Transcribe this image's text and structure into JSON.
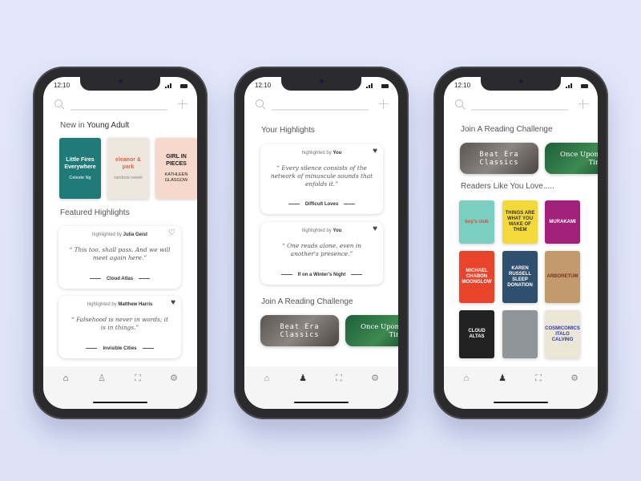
{
  "status_time": "12:10",
  "nav_icons": [
    "home-icon",
    "profile-icon",
    "scan-icon",
    "gear-icon"
  ],
  "screens": [
    {
      "active_nav": 0,
      "section_prefix": "New in",
      "section_genre": "Young Adult",
      "books": [
        {
          "title": "Little Fires Everywhere",
          "author": "Celeste Ng",
          "bg": "#1f7a78",
          "fg": "#ffffff"
        },
        {
          "title": "eleanor & park",
          "author": "rainbow rowell",
          "bg": "#ece6dc",
          "fg": "#e0664e"
        },
        {
          "title": "GIRL IN PIECES",
          "author": "KATHLEEN GLASGOW",
          "bg": "#f6d9cb",
          "fg": "#222222"
        }
      ],
      "featured_heading": "Featured Highlights",
      "highlights": [
        {
          "by_label": "highlighted by",
          "user": "Julia Geist",
          "quote": "“ This too, shall pass. And we will meet again here.”",
          "source": "Cloud Atlas",
          "liked": false
        },
        {
          "by_label": "highlighted by",
          "user": "Matthew Harris",
          "quote": "“ Falsehood is never in words; it is in things.”",
          "source": "Invisible Cities",
          "liked": true
        }
      ]
    },
    {
      "active_nav": 1,
      "heading": "Your Highlights",
      "highlights": [
        {
          "by_label": "highlighted by",
          "user": "You",
          "quote": "“ Every silence consists of the network of minuscule sounds that enfolds it.”",
          "source": "Difficult Loves",
          "liked": true
        },
        {
          "by_label": "highlighted by",
          "user": "You",
          "quote": "“ One reads alone, even in another's presence.”",
          "source": "If on a Winter's Night",
          "liked": true
        }
      ],
      "challenge_heading": "Join A Reading Challenge",
      "challenges": [
        {
          "label": "Beat Era Classics"
        },
        {
          "label": "Once Upon A Time"
        }
      ]
    },
    {
      "active_nav": 1,
      "challenge_heading": "Join A Reading Challenge",
      "challenges": [
        {
          "label": "Beat Era Classics"
        },
        {
          "label": "Once Upon A Time"
        }
      ],
      "readers_heading": "Readers Like You Love.....",
      "books": [
        {
          "title": "boy's club",
          "bg": "#7ccfc0",
          "fg": "#e0463c"
        },
        {
          "title": "THINGS ARE WHAT YOU MAKE OF THEM",
          "bg": "#f4d93a",
          "fg": "#333333"
        },
        {
          "title": "MURAKAMI",
          "bg": "#a0207a",
          "fg": "#ffffff"
        },
        {
          "title": "MICHAEL CHABON MOONGLOW",
          "bg": "#e8442c",
          "fg": "#ffffff"
        },
        {
          "title": "KAREN RUSSELL SLEEP DONATION",
          "bg": "#2f4f6e",
          "fg": "#ffffff"
        },
        {
          "title": "ARBORETUM",
          "bg": "#c29a6c",
          "fg": "#7a3322"
        },
        {
          "title": "CLOUD ALTAS",
          "bg": "#222222",
          "fg": "#ffffff"
        },
        {
          "title": "",
          "bg": "#8f9599",
          "fg": "#ffffff"
        },
        {
          "title": "COSMICOMICS ITALO CALVINO",
          "bg": "#ece6d6",
          "fg": "#2a3cab"
        }
      ]
    }
  ]
}
